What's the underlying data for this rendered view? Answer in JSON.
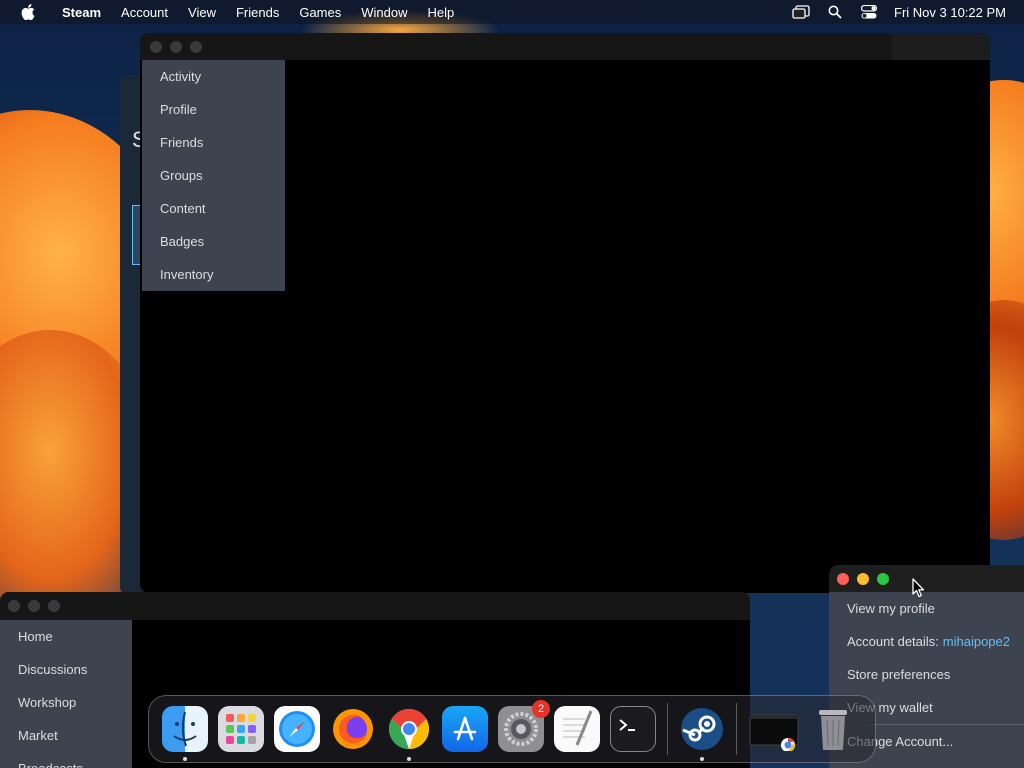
{
  "menubar": {
    "app_name": "Steam",
    "items": [
      "Account",
      "View",
      "Friends",
      "Games",
      "Window",
      "Help"
    ],
    "clock": "Fri Nov 3  10:22 PM"
  },
  "profile_menu": {
    "items": [
      "Activity",
      "Profile",
      "Friends",
      "Groups",
      "Content",
      "Badges",
      "Inventory"
    ]
  },
  "community_nav": {
    "items": [
      "Home",
      "Discussions",
      "Workshop",
      "Market",
      "Broadcasts"
    ]
  },
  "account_menu": {
    "view_profile": "View my profile",
    "account_details_label": "Account details:",
    "username": "mihaipope2",
    "store_preferences": "Store preferences",
    "wallet": "View my wallet",
    "manage_account": "Change Account..."
  },
  "back_window": {
    "letter": "S"
  },
  "dock": {
    "apps": [
      "finder-icon",
      "launchpad-icon",
      "safari-icon",
      "firefox-icon",
      "chrome-icon",
      "app-store-icon",
      "system-settings-icon",
      "textedit-icon",
      "terminal-icon",
      "steam-icon",
      "chrome-window-thumbnail",
      "trash-icon"
    ],
    "system_settings_badge": "2"
  },
  "colors": {
    "steam_menu_bg": "#3d4450",
    "steam_menu_text": "#dcdedf",
    "steam_link": "#66c0f4",
    "traffic_red": "#ff5f57",
    "traffic_yellow": "#febc2e",
    "traffic_green": "#28c840"
  }
}
